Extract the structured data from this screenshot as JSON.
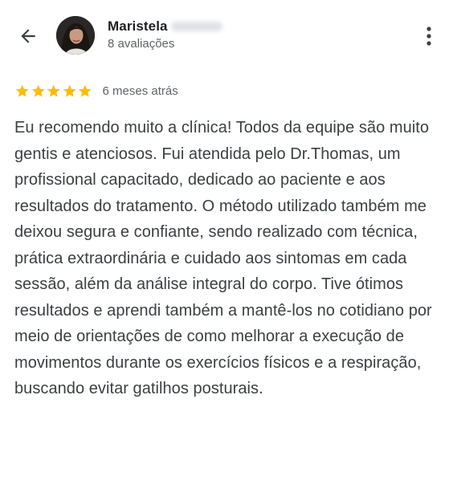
{
  "header": {
    "back_icon": "arrow-left-icon",
    "avatar_icon": "profile-photo",
    "reviewer_name": "Maristela",
    "reviews_count": "8 avaliações",
    "more_icon": "more-vertical-icon"
  },
  "review": {
    "rating": 5,
    "rating_max": 5,
    "star_color": "#fbbc04",
    "date": "6 meses atrás",
    "text": "Eu recomendo muito a clínica! Todos da equipe são muito gentis e atenciosos. Fui atendida pelo Dr.Thomas, um profissional capacitado, dedicado ao paciente e aos resultados do tratamento. O método utilizado também me deixou segura e confiante, sendo realizado com técnica, prática extraordinária e cuidado aos sintomas em cada sessão, além da análise integral do corpo. Tive ótimos resultados e aprendi também a mantê-los no cotidiano por meio de orientações de como melhorar a execução de movimentos durante os exercícios físicos e a respiração, buscando evitar gatilhos posturais."
  }
}
